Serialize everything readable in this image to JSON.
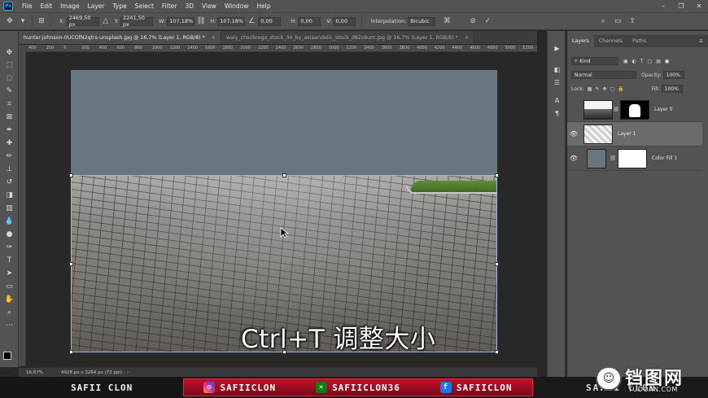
{
  "menubar": {
    "logo": "Ps",
    "items": [
      "File",
      "Edit",
      "Image",
      "Layer",
      "Type",
      "Select",
      "Filter",
      "3D",
      "View",
      "Window",
      "Help"
    ]
  },
  "options": {
    "x_label": "X:",
    "x_value": "2469,50 px",
    "y_label": "Y:",
    "y_value": "2241,50 px",
    "w_label": "W:",
    "w_value": "107,18%",
    "h_label": "H:",
    "h_value": "107,18%",
    "angle_value": "0,00",
    "hskew_label": "H:",
    "hskew_value": "0,00",
    "vskew_label": "V:",
    "vskew_value": "0,00",
    "interp_label": "Interpolation:",
    "interp_value": "Bicubic"
  },
  "tabs": [
    {
      "label": "hunter-johnson-0UCGfN2qtrs-unsplash.jpg @ 16,7% (Layer 1, RGB/8) *",
      "close": "×"
    },
    {
      "label": "waly_chsobrego_stock_34_by_asiaandeiic_stock_d82s9um.jpg @ 16,7% (Layer 1, RGB/8) *",
      "close": "×"
    }
  ],
  "rulers": {
    "top": [
      "400",
      "200",
      "0",
      "200",
      "400",
      "600",
      "800",
      "1000",
      "1200",
      "1400",
      "1600",
      "1800",
      "2000",
      "2200",
      "2400",
      "2600",
      "2800",
      "3000",
      "3200",
      "3400",
      "3600",
      "3800",
      "4000",
      "4200",
      "4400",
      "4600",
      "4800",
      "5000",
      "5200"
    ]
  },
  "canvas": {
    "subtitle": "Ctrl+T 调整大小",
    "colors": {
      "sky": "#687680",
      "pavement": "#8c8a86",
      "grass": "#4e7d32"
    }
  },
  "status": {
    "zoom": "16,67%",
    "doc_info": "4928 px x 3264 px (72 ppi)",
    "arrow": "›"
  },
  "layers_panel": {
    "tabs": [
      "Layers",
      "Channels",
      "Paths"
    ],
    "search_placeholder": "Kind",
    "blend_mode": "Normal",
    "opacity_label": "Opacity:",
    "opacity_value": "100%",
    "lock_label": "Lock:",
    "fill_label": "Fill:",
    "fill_value": "100%",
    "layers": [
      {
        "name": "Layer 0",
        "visible": false,
        "selected": false
      },
      {
        "name": "Layer 1",
        "visible": true,
        "selected": true
      },
      {
        "name": "Color Fill 1",
        "visible": true,
        "selected": false
      }
    ]
  },
  "banner": {
    "name": "SAFII CLON",
    "instagram": "SAFIICLON",
    "xbox": "SAFIICLON36",
    "facebook": "SAFIICLON",
    "right": "SAFII CLON",
    "colors": {
      "accent": "#c0102a"
    }
  },
  "watermark": {
    "logo": "☺",
    "text": "铛图网",
    "url": "TUDOAN.COM"
  }
}
